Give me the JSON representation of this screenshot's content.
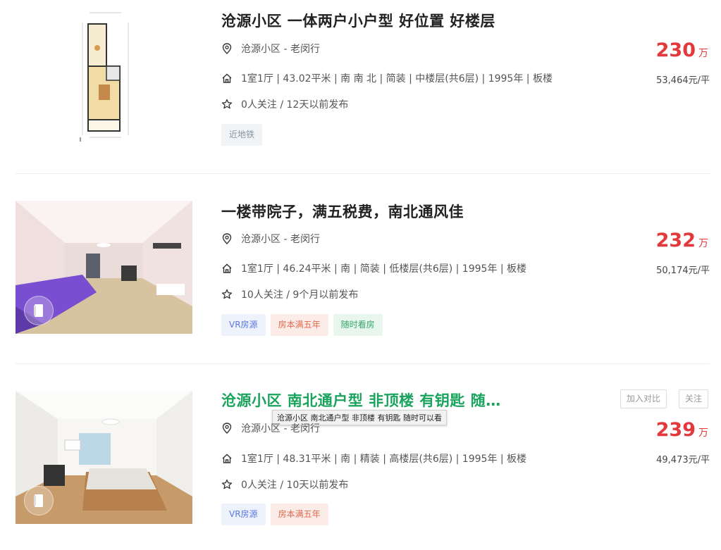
{
  "listings": [
    {
      "title": "沧源小区 一体两户小户型 好位置 好楼层",
      "location": "沧源小区 - 老闵行",
      "details": "1室1厅 | 43.02平米 | 南 南 北 | 简装 | 中楼层(共6层) | 1995年 | 板楼",
      "follow": "0人关注 / 12天以前发布",
      "tags": [
        "近地铁"
      ],
      "price": "230",
      "price_unit": "万",
      "unit_price": "53,464元/平"
    },
    {
      "title": "一楼带院子，满五税费，南北通风佳",
      "location": "沧源小区 - 老闵行",
      "details": "1室1厅 | 46.24平米 | 南 | 简装 | 低楼层(共6层) | 1995年 | 板楼",
      "follow": "10人关注 / 9个月以前发布",
      "tags": [
        "VR房源",
        "房本满五年",
        "随时看房"
      ],
      "price": "232",
      "price_unit": "万",
      "unit_price": "50,174元/平"
    },
    {
      "title": "沧源小区 南北通户型 非顶楼 有钥匙 随…",
      "location": "沧源小区 - 老闵行",
      "details": "1室1厅 | 48.31平米 | 南 | 精装 | 高楼层(共6层) | 1995年 | 板楼",
      "follow": "0人关注 / 10天以前发布",
      "tags": [
        "VR房源",
        "房本满五年"
      ],
      "price": "239",
      "price_unit": "万",
      "unit_price": "49,473元/平",
      "compare_label": "加入对比",
      "follow_label": "关注",
      "tooltip": "沧源小区 南北通户型 非顶楼 有钥匙 随时可以看"
    }
  ],
  "colors": {
    "price": "#e4393c",
    "title_hover": "#1aa35c"
  },
  "icons": [
    "location-pin-icon",
    "house-icon",
    "star-icon",
    "vr-icon"
  ]
}
